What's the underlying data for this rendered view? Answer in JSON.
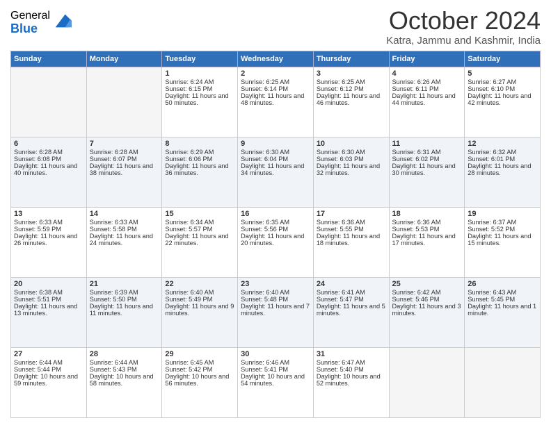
{
  "logo": {
    "general": "General",
    "blue": "Blue"
  },
  "header": {
    "month": "October 2024",
    "location": "Katra, Jammu and Kashmir, India"
  },
  "days_of_week": [
    "Sunday",
    "Monday",
    "Tuesday",
    "Wednesday",
    "Thursday",
    "Friday",
    "Saturday"
  ],
  "weeks": [
    [
      {
        "day": "",
        "sunrise": "",
        "sunset": "",
        "daylight": "",
        "empty": true
      },
      {
        "day": "",
        "sunrise": "",
        "sunset": "",
        "daylight": "",
        "empty": true
      },
      {
        "day": "1",
        "sunrise": "Sunrise: 6:24 AM",
        "sunset": "Sunset: 6:15 PM",
        "daylight": "Daylight: 11 hours and 50 minutes.",
        "empty": false
      },
      {
        "day": "2",
        "sunrise": "Sunrise: 6:25 AM",
        "sunset": "Sunset: 6:14 PM",
        "daylight": "Daylight: 11 hours and 48 minutes.",
        "empty": false
      },
      {
        "day": "3",
        "sunrise": "Sunrise: 6:25 AM",
        "sunset": "Sunset: 6:12 PM",
        "daylight": "Daylight: 11 hours and 46 minutes.",
        "empty": false
      },
      {
        "day": "4",
        "sunrise": "Sunrise: 6:26 AM",
        "sunset": "Sunset: 6:11 PM",
        "daylight": "Daylight: 11 hours and 44 minutes.",
        "empty": false
      },
      {
        "day": "5",
        "sunrise": "Sunrise: 6:27 AM",
        "sunset": "Sunset: 6:10 PM",
        "daylight": "Daylight: 11 hours and 42 minutes.",
        "empty": false
      }
    ],
    [
      {
        "day": "6",
        "sunrise": "Sunrise: 6:28 AM",
        "sunset": "Sunset: 6:08 PM",
        "daylight": "Daylight: 11 hours and 40 minutes.",
        "empty": false
      },
      {
        "day": "7",
        "sunrise": "Sunrise: 6:28 AM",
        "sunset": "Sunset: 6:07 PM",
        "daylight": "Daylight: 11 hours and 38 minutes.",
        "empty": false
      },
      {
        "day": "8",
        "sunrise": "Sunrise: 6:29 AM",
        "sunset": "Sunset: 6:06 PM",
        "daylight": "Daylight: 11 hours and 36 minutes.",
        "empty": false
      },
      {
        "day": "9",
        "sunrise": "Sunrise: 6:30 AM",
        "sunset": "Sunset: 6:04 PM",
        "daylight": "Daylight: 11 hours and 34 minutes.",
        "empty": false
      },
      {
        "day": "10",
        "sunrise": "Sunrise: 6:30 AM",
        "sunset": "Sunset: 6:03 PM",
        "daylight": "Daylight: 11 hours and 32 minutes.",
        "empty": false
      },
      {
        "day": "11",
        "sunrise": "Sunrise: 6:31 AM",
        "sunset": "Sunset: 6:02 PM",
        "daylight": "Daylight: 11 hours and 30 minutes.",
        "empty": false
      },
      {
        "day": "12",
        "sunrise": "Sunrise: 6:32 AM",
        "sunset": "Sunset: 6:01 PM",
        "daylight": "Daylight: 11 hours and 28 minutes.",
        "empty": false
      }
    ],
    [
      {
        "day": "13",
        "sunrise": "Sunrise: 6:33 AM",
        "sunset": "Sunset: 5:59 PM",
        "daylight": "Daylight: 11 hours and 26 minutes.",
        "empty": false
      },
      {
        "day": "14",
        "sunrise": "Sunrise: 6:33 AM",
        "sunset": "Sunset: 5:58 PM",
        "daylight": "Daylight: 11 hours and 24 minutes.",
        "empty": false
      },
      {
        "day": "15",
        "sunrise": "Sunrise: 6:34 AM",
        "sunset": "Sunset: 5:57 PM",
        "daylight": "Daylight: 11 hours and 22 minutes.",
        "empty": false
      },
      {
        "day": "16",
        "sunrise": "Sunrise: 6:35 AM",
        "sunset": "Sunset: 5:56 PM",
        "daylight": "Daylight: 11 hours and 20 minutes.",
        "empty": false
      },
      {
        "day": "17",
        "sunrise": "Sunrise: 6:36 AM",
        "sunset": "Sunset: 5:55 PM",
        "daylight": "Daylight: 11 hours and 18 minutes.",
        "empty": false
      },
      {
        "day": "18",
        "sunrise": "Sunrise: 6:36 AM",
        "sunset": "Sunset: 5:53 PM",
        "daylight": "Daylight: 11 hours and 17 minutes.",
        "empty": false
      },
      {
        "day": "19",
        "sunrise": "Sunrise: 6:37 AM",
        "sunset": "Sunset: 5:52 PM",
        "daylight": "Daylight: 11 hours and 15 minutes.",
        "empty": false
      }
    ],
    [
      {
        "day": "20",
        "sunrise": "Sunrise: 6:38 AM",
        "sunset": "Sunset: 5:51 PM",
        "daylight": "Daylight: 11 hours and 13 minutes.",
        "empty": false
      },
      {
        "day": "21",
        "sunrise": "Sunrise: 6:39 AM",
        "sunset": "Sunset: 5:50 PM",
        "daylight": "Daylight: 11 hours and 11 minutes.",
        "empty": false
      },
      {
        "day": "22",
        "sunrise": "Sunrise: 6:40 AM",
        "sunset": "Sunset: 5:49 PM",
        "daylight": "Daylight: 11 hours and 9 minutes.",
        "empty": false
      },
      {
        "day": "23",
        "sunrise": "Sunrise: 6:40 AM",
        "sunset": "Sunset: 5:48 PM",
        "daylight": "Daylight: 11 hours and 7 minutes.",
        "empty": false
      },
      {
        "day": "24",
        "sunrise": "Sunrise: 6:41 AM",
        "sunset": "Sunset: 5:47 PM",
        "daylight": "Daylight: 11 hours and 5 minutes.",
        "empty": false
      },
      {
        "day": "25",
        "sunrise": "Sunrise: 6:42 AM",
        "sunset": "Sunset: 5:46 PM",
        "daylight": "Daylight: 11 hours and 3 minutes.",
        "empty": false
      },
      {
        "day": "26",
        "sunrise": "Sunrise: 6:43 AM",
        "sunset": "Sunset: 5:45 PM",
        "daylight": "Daylight: 11 hours and 1 minute.",
        "empty": false
      }
    ],
    [
      {
        "day": "27",
        "sunrise": "Sunrise: 6:44 AM",
        "sunset": "Sunset: 5:44 PM",
        "daylight": "Daylight: 10 hours and 59 minutes.",
        "empty": false
      },
      {
        "day": "28",
        "sunrise": "Sunrise: 6:44 AM",
        "sunset": "Sunset: 5:43 PM",
        "daylight": "Daylight: 10 hours and 58 minutes.",
        "empty": false
      },
      {
        "day": "29",
        "sunrise": "Sunrise: 6:45 AM",
        "sunset": "Sunset: 5:42 PM",
        "daylight": "Daylight: 10 hours and 56 minutes.",
        "empty": false
      },
      {
        "day": "30",
        "sunrise": "Sunrise: 6:46 AM",
        "sunset": "Sunset: 5:41 PM",
        "daylight": "Daylight: 10 hours and 54 minutes.",
        "empty": false
      },
      {
        "day": "31",
        "sunrise": "Sunrise: 6:47 AM",
        "sunset": "Sunset: 5:40 PM",
        "daylight": "Daylight: 10 hours and 52 minutes.",
        "empty": false
      },
      {
        "day": "",
        "sunrise": "",
        "sunset": "",
        "daylight": "",
        "empty": true
      },
      {
        "day": "",
        "sunrise": "",
        "sunset": "",
        "daylight": "",
        "empty": true
      }
    ]
  ]
}
